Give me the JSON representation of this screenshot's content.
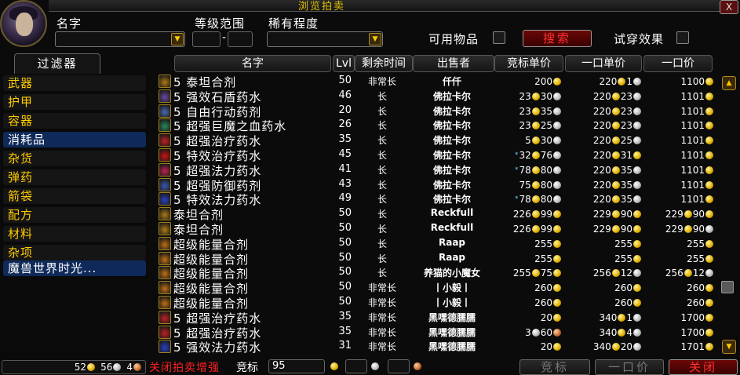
{
  "window": {
    "title": "浏览拍卖",
    "close_label": "X"
  },
  "search": {
    "name_label": "名字",
    "level_label": "等级范围",
    "level_dash": "-",
    "rarity_label": "稀有程度",
    "usable_label": "可用物品",
    "search_label": "搜索",
    "tryon_label": "试穿效果"
  },
  "filter": {
    "header": "过滤器",
    "items": [
      "武器",
      "护甲",
      "容器",
      "消耗品",
      "杂货",
      "弹药",
      "箭袋",
      "配方",
      "材料",
      "杂项",
      "魔兽世界时光..."
    ],
    "selected": [
      "消耗品",
      "魔兽世界时光..."
    ]
  },
  "columns": [
    "名字",
    "Lvl",
    "剩余时间",
    "出售者",
    "竞标单价",
    "一口单价",
    "一口价"
  ],
  "rows": [
    {
      "name": "5 泰坦合剂",
      "icon": "#b07a10",
      "lvl": "50",
      "time": "非常长",
      "seller": "仟仟",
      "bid": [
        [
          "200",
          "g"
        ]
      ],
      "unit": [
        [
          "220",
          "g"
        ],
        [
          "1",
          "s"
        ]
      ],
      "buyout": [
        [
          "1100",
          "g"
        ]
      ]
    },
    {
      "name": "5 强效石盾药水",
      "icon": "#6a4aa0",
      "lvl": "46",
      "time": "长",
      "seller": "佛拉卡尔",
      "bid": [
        [
          "23",
          "g"
        ],
        [
          "30",
          "s"
        ]
      ],
      "unit": [
        [
          "220",
          "g"
        ],
        [
          "23",
          "s"
        ]
      ],
      "buyout": [
        [
          "1101",
          "g"
        ]
      ]
    },
    {
      "name": "5 自由行动药剂",
      "icon": "#4a6ab0",
      "lvl": "20",
      "time": "长",
      "seller": "佛拉卡尔",
      "bid": [
        [
          "23",
          "g"
        ],
        [
          "35",
          "s"
        ]
      ],
      "unit": [
        [
          "220",
          "g"
        ],
        [
          "23",
          "s"
        ]
      ],
      "buyout": [
        [
          "1101",
          "g"
        ]
      ]
    },
    {
      "name": "5 超强巨魔之血药水",
      "icon": "#2a8a5a",
      "lvl": "26",
      "time": "长",
      "seller": "佛拉卡尔",
      "bid": [
        [
          "23",
          "g"
        ],
        [
          "25",
          "s"
        ]
      ],
      "unit": [
        [
          "220",
          "g"
        ],
        [
          "23",
          "s"
        ]
      ],
      "buyout": [
        [
          "1101",
          "g"
        ]
      ]
    },
    {
      "name": "5 超强治疗药水",
      "icon": "#c02020",
      "lvl": "35",
      "time": "长",
      "seller": "佛拉卡尔",
      "bid": [
        [
          "5",
          "g"
        ],
        [
          "30",
          "s"
        ]
      ],
      "unit": [
        [
          "220",
          "g"
        ],
        [
          "25",
          "s"
        ]
      ],
      "buyout": [
        [
          "1101",
          "g"
        ]
      ]
    },
    {
      "name": "5 特效治疗药水",
      "icon": "#d01010",
      "lvl": "45",
      "time": "长",
      "seller": "佛拉卡尔",
      "star": true,
      "bid": [
        [
          "32",
          "g"
        ],
        [
          "76",
          "s"
        ]
      ],
      "unit": [
        [
          "220",
          "g"
        ],
        [
          "31",
          "g"
        ]
      ],
      "buyout": [
        [
          "1101",
          "g"
        ]
      ]
    },
    {
      "name": "5 超强法力药水",
      "icon": "#c02050",
      "lvl": "41",
      "time": "长",
      "seller": "佛拉卡尔",
      "star": true,
      "bid": [
        [
          "78",
          "g"
        ],
        [
          "80",
          "s"
        ]
      ],
      "unit": [
        [
          "220",
          "g"
        ],
        [
          "35",
          "s"
        ]
      ],
      "buyout": [
        [
          "1101",
          "g"
        ]
      ]
    },
    {
      "name": "5 超强防御药剂",
      "icon": "#3a5ab0",
      "lvl": "43",
      "time": "长",
      "seller": "佛拉卡尔",
      "bid": [
        [
          "75",
          "g"
        ],
        [
          "80",
          "s"
        ]
      ],
      "unit": [
        [
          "220",
          "g"
        ],
        [
          "35",
          "s"
        ]
      ],
      "buyout": [
        [
          "1101",
          "g"
        ]
      ]
    },
    {
      "name": "5 特效法力药水",
      "icon": "#2a40c0",
      "lvl": "49",
      "time": "长",
      "seller": "佛拉卡尔",
      "star": true,
      "bid": [
        [
          "78",
          "g"
        ],
        [
          "80",
          "s"
        ]
      ],
      "unit": [
        [
          "220",
          "g"
        ],
        [
          "35",
          "s"
        ]
      ],
      "buyout": [
        [
          "1101",
          "g"
        ]
      ]
    },
    {
      "name": "泰坦合剂",
      "icon": "#b07a10",
      "lvl": "50",
      "time": "长",
      "seller": "Reckfull",
      "bid": [
        [
          "226",
          "g"
        ],
        [
          "99",
          "g"
        ]
      ],
      "unit": [
        [
          "229",
          "g"
        ],
        [
          "90",
          "g"
        ]
      ],
      "buyout": [
        [
          "229",
          "g"
        ],
        [
          "90",
          "g"
        ]
      ]
    },
    {
      "name": "泰坦合剂",
      "icon": "#b07a10",
      "lvl": "50",
      "time": "长",
      "seller": "Reckfull",
      "bid": [
        [
          "226",
          "g"
        ],
        [
          "99",
          "g"
        ]
      ],
      "unit": [
        [
          "229",
          "g"
        ],
        [
          "90",
          "g"
        ]
      ],
      "buyout": [
        [
          "229",
          "g"
        ],
        [
          "90",
          "s"
        ]
      ]
    },
    {
      "name": "超级能量合剂",
      "icon": "#c07010",
      "lvl": "50",
      "time": "长",
      "seller": "Raap",
      "bid": [
        [
          "255",
          "g"
        ]
      ],
      "unit": [
        [
          "255",
          "g"
        ]
      ],
      "buyout": [
        [
          "255",
          "g"
        ]
      ]
    },
    {
      "name": "超级能量合剂",
      "icon": "#c07010",
      "lvl": "50",
      "time": "长",
      "seller": "Raap",
      "bid": [
        [
          "255",
          "g"
        ]
      ],
      "unit": [
        [
          "255",
          "g"
        ]
      ],
      "buyout": [
        [
          "255",
          "g"
        ]
      ]
    },
    {
      "name": "超级能量合剂",
      "icon": "#c07010",
      "lvl": "50",
      "time": "长",
      "seller": "养猫的小魔女",
      "bid": [
        [
          "255",
          "g"
        ],
        [
          "75",
          "g"
        ]
      ],
      "unit": [
        [
          "256",
          "g"
        ],
        [
          "12",
          "s"
        ]
      ],
      "buyout": [
        [
          "256",
          "g"
        ],
        [
          "12",
          "s"
        ]
      ]
    },
    {
      "name": "超级能量合剂",
      "icon": "#c07010",
      "lvl": "50",
      "time": "非常长",
      "seller": "丨小毅丨",
      "bid": [
        [
          "260",
          "g"
        ]
      ],
      "unit": [
        [
          "260",
          "g"
        ]
      ],
      "buyout": [
        [
          "260",
          "g"
        ]
      ]
    },
    {
      "name": "超级能量合剂",
      "icon": "#c07010",
      "lvl": "50",
      "time": "非常长",
      "seller": "丨小毅丨",
      "bid": [
        [
          "260",
          "g"
        ]
      ],
      "unit": [
        [
          "260",
          "g"
        ]
      ],
      "buyout": [
        [
          "260",
          "g"
        ]
      ]
    },
    {
      "name": "5 超强治疗药水",
      "icon": "#c02020",
      "lvl": "35",
      "time": "非常长",
      "seller": "黑嘿德臑臑",
      "bid": [
        [
          "20",
          "g"
        ]
      ],
      "unit": [
        [
          "340",
          "g"
        ],
        [
          "1",
          "s"
        ]
      ],
      "buyout": [
        [
          "1700",
          "g"
        ]
      ]
    },
    {
      "name": "5 超强治疗药水",
      "icon": "#c02020",
      "lvl": "35",
      "time": "非常长",
      "seller": "黑嘿德臑臑",
      "bid": [
        [
          "3",
          "s"
        ],
        [
          "60",
          "c"
        ]
      ],
      "unit": [
        [
          "340",
          "g"
        ],
        [
          "4",
          "s"
        ]
      ],
      "buyout": [
        [
          "1700",
          "g"
        ]
      ]
    },
    {
      "name": "5 强效法力药水",
      "icon": "#2a40c0",
      "lvl": "31",
      "time": "非常长",
      "seller": "黑嘿德臑臑",
      "bid": [
        [
          "20",
          "g"
        ]
      ],
      "unit": [
        [
          "340",
          "g"
        ],
        [
          "20",
          "s"
        ]
      ],
      "buyout": [
        [
          "1701",
          "g"
        ]
      ]
    }
  ],
  "bottom": {
    "money": [
      [
        "52",
        "g"
      ],
      [
        "56",
        "s"
      ],
      [
        "4",
        "c"
      ]
    ],
    "toggle_label": "关闭拍卖增强",
    "bid_label": "竞标",
    "bid_value": "95",
    "bid_button": "竞标",
    "buyout_button": "一口价",
    "close_button": "关闭"
  }
}
